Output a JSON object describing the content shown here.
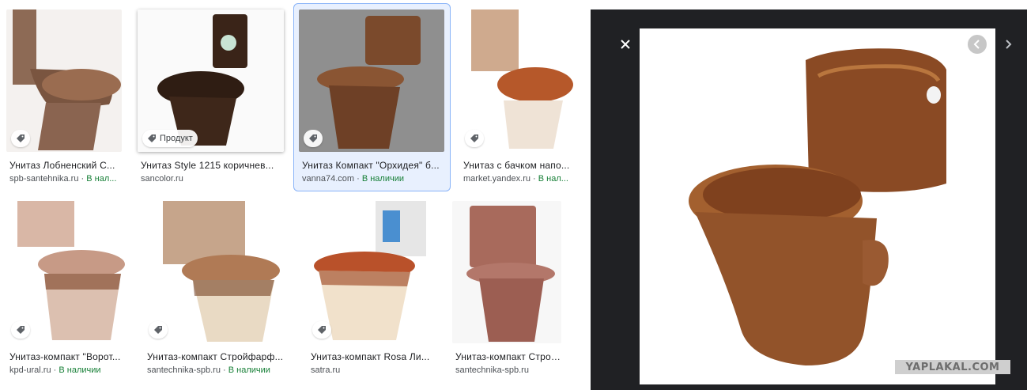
{
  "results_row1": [
    {
      "title": "Унитаз Лобненский С...",
      "source": "spb-santehnika.ru",
      "stock": "В нал...",
      "badge": ""
    },
    {
      "title": "Унитаз Style 1215 коричнев...",
      "source": "sancolor.ru",
      "stock": "",
      "badge": "Продукт"
    },
    {
      "title": "Унитаз Компакт \"Орхидея\" б...",
      "source": "vanna74.com",
      "stock": "В наличии",
      "badge": ""
    },
    {
      "title": "Унитаз с бачком напо...",
      "source": "market.yandex.ru",
      "stock": "В нал...",
      "badge": ""
    }
  ],
  "results_row2": [
    {
      "title": "Унитаз-компакт \"Ворот...",
      "source": "kpd-ural.ru",
      "stock": "В наличии",
      "badge": ""
    },
    {
      "title": "Унитаз-компакт Стройфарф...",
      "source": "santechnika-spb.ru",
      "stock": "В наличии",
      "badge": ""
    },
    {
      "title": "Унитаз-компакт Rosa Ли...",
      "source": "satra.ru",
      "stock": "",
      "badge": ""
    },
    {
      "title": "Унитаз-компакт Строй...",
      "source": "santechnika-spb.ru",
      "stock": "",
      "badge": ""
    }
  ],
  "separator": " · ",
  "viewer": {
    "watermark": "YAPLAKAL.COM"
  },
  "colors": {
    "stock_green": "#188038",
    "selected_bg": "#e8f0fe",
    "selected_border": "#8ab4f8",
    "viewer_bg": "#202124"
  },
  "icons": {
    "tag": "tag-icon",
    "close": "close-icon",
    "prev": "chevron-left-icon",
    "next": "chevron-right-icon"
  }
}
